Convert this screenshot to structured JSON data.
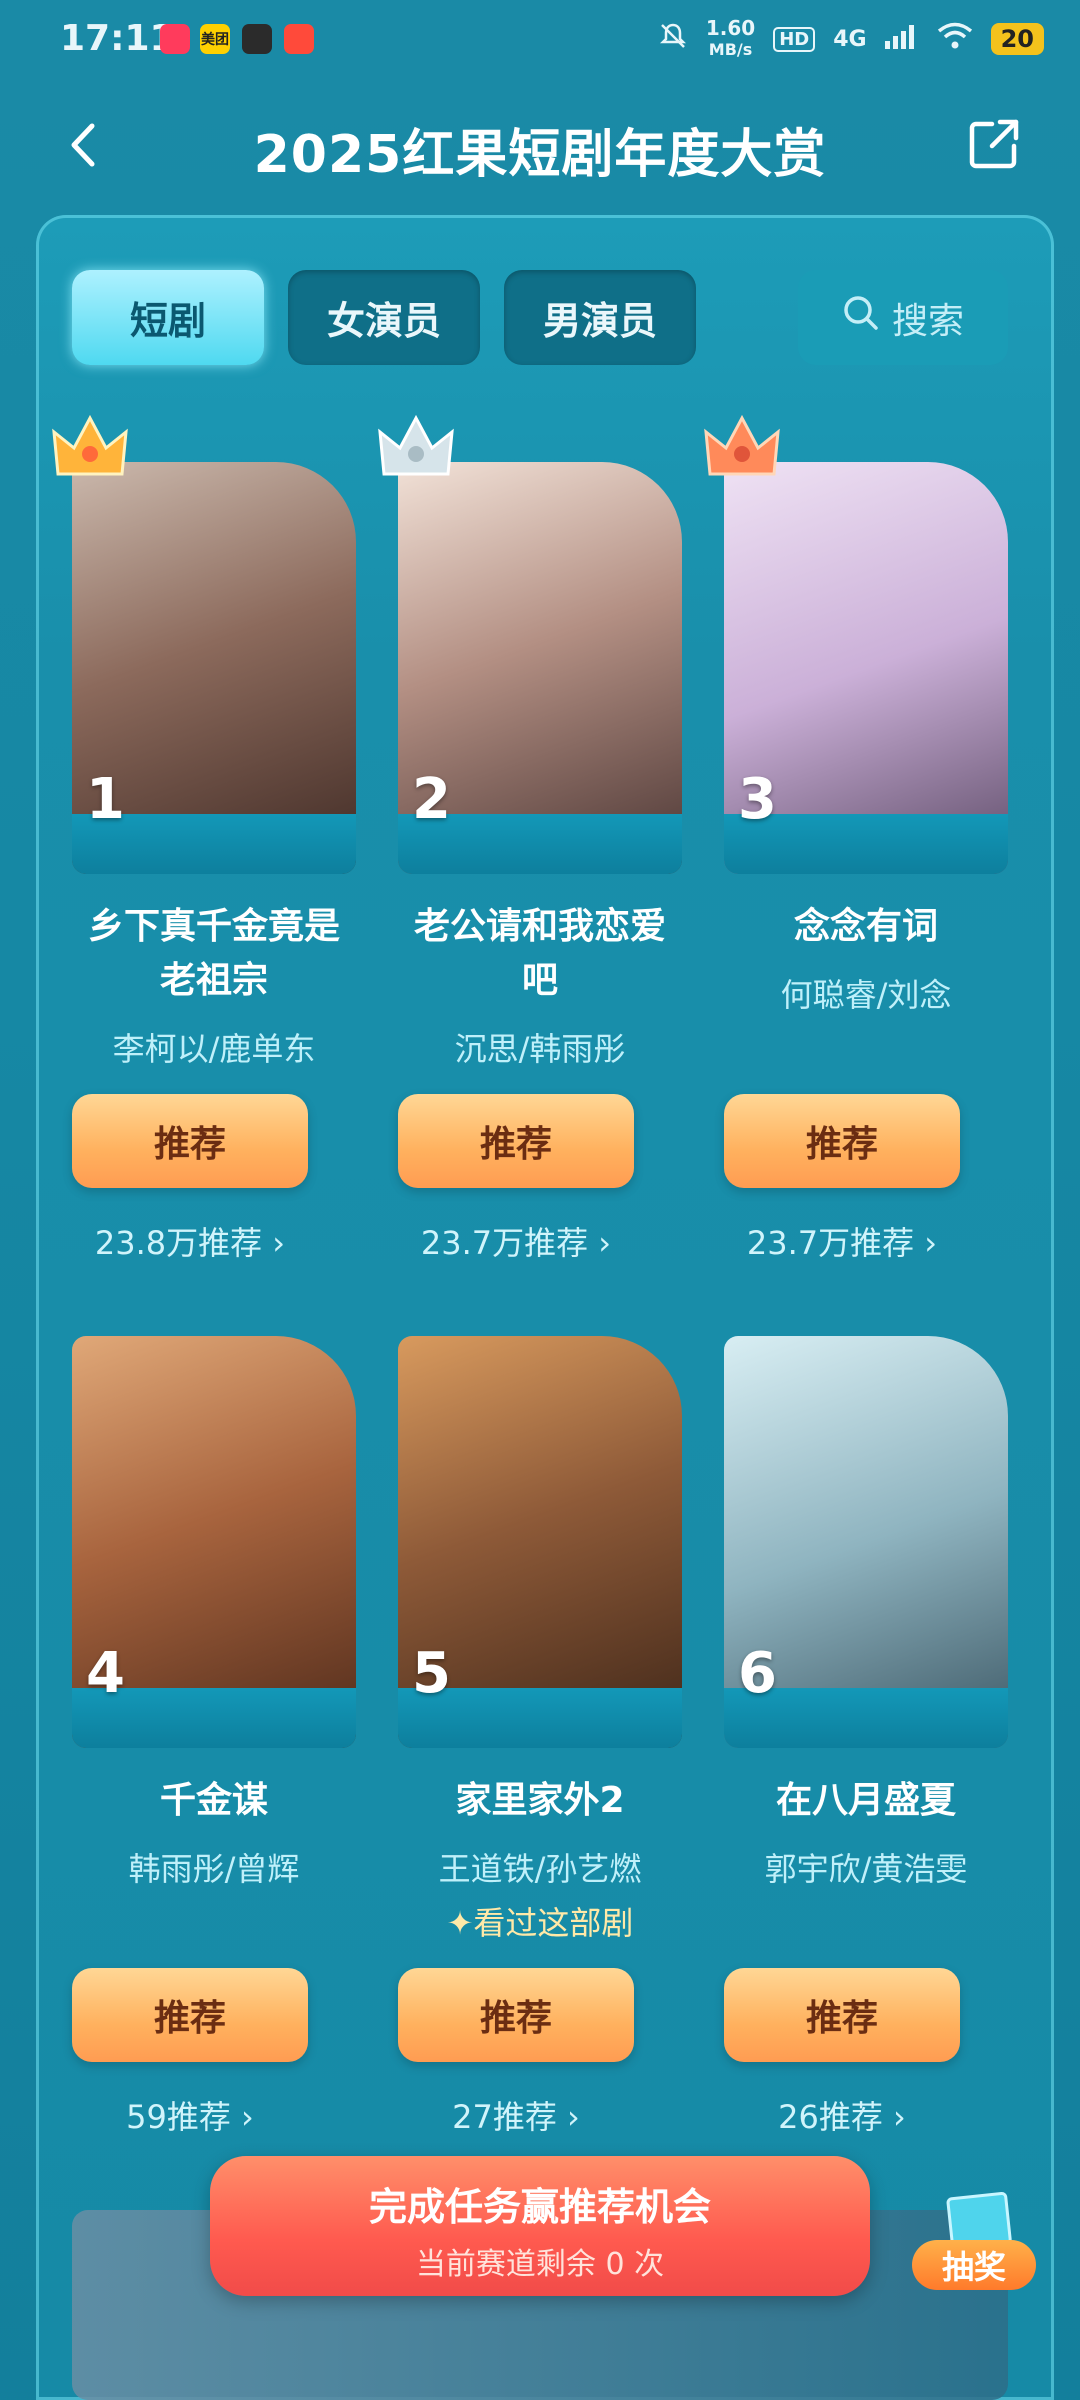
{
  "status_bar": {
    "time": "17:11",
    "speed_value": "1.60",
    "speed_unit": "MB/s",
    "hd": "HD",
    "network": "4G",
    "battery": "20",
    "app_icons": [
      "red-app-icon",
      "meituan-icon",
      "book-app-icon",
      "shopping-app-icon"
    ],
    "meituan_label": "美团"
  },
  "header": {
    "title": "2025红果短剧年度大赏"
  },
  "tabs": [
    {
      "label": "短剧",
      "active": true
    },
    {
      "label": "女演员",
      "active": false
    },
    {
      "label": "男演员",
      "active": false
    }
  ],
  "search": {
    "label": "搜索"
  },
  "items": [
    {
      "rank": "1",
      "name_line1": "乡下真千金竟是",
      "name_line2": "老祖宗",
      "actors": "李柯以/鹿单东",
      "button": "推荐",
      "count": "23.8万推荐 ›",
      "crown": "gold",
      "poster_colors": [
        "#b8a69a",
        "#5a3e34"
      ]
    },
    {
      "rank": "2",
      "name_line1": "老公请和我恋爱",
      "name_line2": "吧",
      "actors": "沉思/韩雨彤",
      "button": "推荐",
      "count": "23.7万推荐 ›",
      "crown": "silver",
      "poster_colors": [
        "#e9d6cc",
        "#7b5c56"
      ]
    },
    {
      "rank": "3",
      "name_line1": "念念有词",
      "name_line2": "",
      "actors": "何聪睿/刘念",
      "button": "推荐",
      "count": "23.7万推荐 ›",
      "crown": "bronze",
      "poster_colors": [
        "#e7d6f0",
        "#b49acb"
      ]
    },
    {
      "rank": "4",
      "name_line1": "千金谋",
      "name_line2": "",
      "actors": "韩雨彤/曾辉",
      "button": "推荐",
      "count": "59推荐 ›",
      "crown": "",
      "poster_colors": [
        "#c98a5e",
        "#6e3a24"
      ]
    },
    {
      "rank": "5",
      "name_line1": "家里家外2",
      "name_line2": "",
      "actors": "王道铁/孙艺燃",
      "watched": "✦看过这部剧",
      "button": "推荐",
      "count": "27推荐 ›",
      "crown": "",
      "poster_colors": [
        "#c97d4c",
        "#5a3521"
      ]
    },
    {
      "rank": "6",
      "name_line1": "在八月盛夏",
      "name_line2": "",
      "actors": "郭宇欣/黄浩雯",
      "button": "推荐",
      "count": "26推荐 ›",
      "crown": "",
      "poster_colors": [
        "#bfe1ea",
        "#4c6f7c"
      ]
    }
  ],
  "banner": {
    "main": "完成任务赢推荐机会",
    "sub": "当前赛道剩余 0 次"
  },
  "lottery": {
    "label": "抽奖"
  },
  "colors": {
    "background": "#1688a4",
    "button_gradient_top": "#ffd795",
    "button_gradient_bottom": "#ff9c52",
    "banner": "#ff5a4f"
  }
}
